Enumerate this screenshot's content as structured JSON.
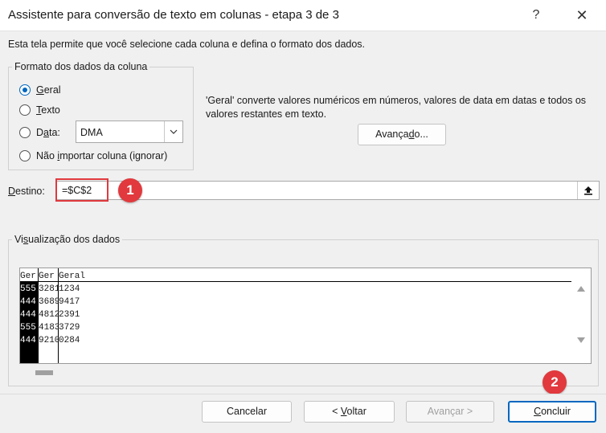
{
  "window": {
    "title": "Assistente para conversão de texto em colunas - etapa 3 de 3",
    "help_glyph": "?",
    "close_glyph": "✕"
  },
  "intro_text": "Esta tela permite que você selecione cada coluna e defina o formato dos dados.",
  "format_group": {
    "legend": "Formato dos dados da coluna",
    "options": [
      {
        "pre": "",
        "key": "G",
        "post": "eral",
        "selected": true
      },
      {
        "pre": "",
        "key": "T",
        "post": "exto",
        "selected": false
      },
      {
        "pre": "D",
        "key": "a",
        "post": "ta:",
        "selected": false
      },
      {
        "pre": "Não ",
        "key": "i",
        "post": "mportar coluna (ignorar)",
        "selected": false
      }
    ],
    "date_select_value": "DMA"
  },
  "description": "'Geral' converte valores numéricos em números, valores de data em datas e todos os valores restantes em texto.",
  "advanced_button": {
    "pre": "Avança",
    "key": "d",
    "post": "o..."
  },
  "destination": {
    "label_key": "D",
    "label_rest": "estino:",
    "value": "=$C$2"
  },
  "annotations": {
    "badge1": "1",
    "badge2": "2",
    "highlight_color": "#e0393e",
    "badge_color": "#e1393d"
  },
  "preview_group": {
    "legend_pre": "Vi",
    "legend_key": "s",
    "legend_post": "ualização dos dados",
    "headers": [
      "Ger",
      "Ger",
      "Geral"
    ],
    "rows": [
      [
        "555",
        "3281",
        "1234"
      ],
      [
        "444",
        "3689",
        "9417"
      ],
      [
        "444",
        "4812",
        "2391"
      ],
      [
        "555",
        "4183",
        "3729"
      ],
      [
        "444",
        "9210",
        "0284"
      ]
    ]
  },
  "footer": {
    "cancel": "Cancelar",
    "back_pre": "< ",
    "back_key": "V",
    "back_post": "oltar",
    "next": "Avançar >",
    "finish_key": "C",
    "finish_post": "oncluir"
  },
  "colors": {
    "accent": "#0067c0"
  }
}
